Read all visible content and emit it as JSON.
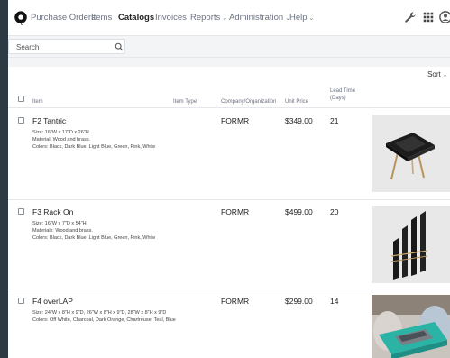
{
  "nav": {
    "items": [
      {
        "label": "Purchase Orders",
        "active": false
      },
      {
        "label": "Items",
        "active": false
      },
      {
        "label": "Catalogs",
        "active": true
      },
      {
        "label": "Invoices",
        "active": false
      },
      {
        "label": "Reports",
        "active": false,
        "dropdown": true
      },
      {
        "label": "Administration",
        "active": false,
        "dropdown": true
      },
      {
        "label": "Help",
        "active": false,
        "dropdown": true
      }
    ],
    "caret": "⌄",
    "icons": [
      "logo-icon",
      "wrench-icon",
      "apps-grid-icon",
      "user-icon"
    ]
  },
  "search": {
    "placeholder": "Search",
    "value": ""
  },
  "sort": {
    "label": "Sort",
    "caret": "⌄"
  },
  "table": {
    "columns": {
      "item": "Item",
      "item_type": "Item Type",
      "company": "Company/Organization",
      "unit_price": "Unit Price",
      "lead_time_1": "Lead Time",
      "lead_time_2": "(Days)"
    },
    "rows": [
      {
        "name": "F2 Tantric",
        "desc": [
          "Size: 16\"W x 17\"D x 26\"H.",
          "Material: Wood and brass.",
          "Colors: Black, Dark Blue, Light Blue, Green, Pink, White"
        ],
        "company": "FORMR",
        "price": "$349.00",
        "lead": "21"
      },
      {
        "name": "F3 Rack On",
        "desc": [
          "Size: 16\"W x 7\"D x 54\"H",
          "Materials: Wood and brass.",
          "Colors: Black, Dark Blue, Light Blue, Green, Pink, White"
        ],
        "company": "FORMR",
        "price": "$499.00",
        "lead": "20"
      },
      {
        "name": "F4 overLAP",
        "desc": [
          "Size: 24\"W x 8\"H x 9\"D, 26\"W x 8\"H x 9\"D, 28\"W x 8\"H x 9\"D",
          "Colors: Off White, Charcoal, Dark Orange, Chartreuse, Teal, Blue"
        ],
        "company": "FORMR",
        "price": "$299.00",
        "lead": "14"
      }
    ]
  },
  "colors": {
    "accent": "#222222",
    "nav_text": "#6b7280",
    "page_bg": "#f3f4f6",
    "frame": "#2b3a43",
    "overlap_teal": "#2bb3a6"
  }
}
